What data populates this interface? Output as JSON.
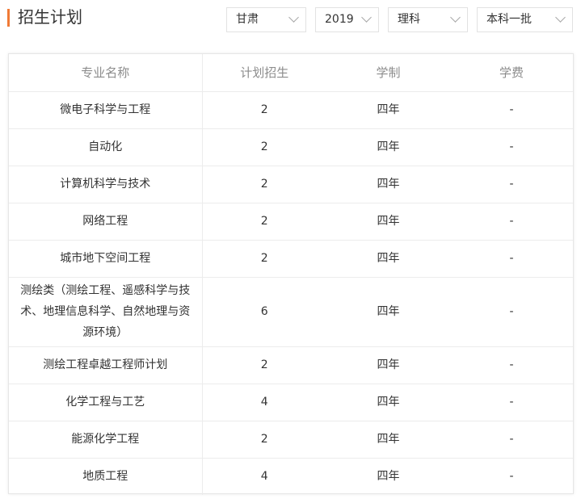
{
  "page": {
    "title": "招生计划"
  },
  "filters": {
    "province": "甘肃",
    "year": "2019",
    "subject": "理科",
    "batch": "本科一批"
  },
  "table": {
    "headers": [
      "专业名称",
      "计划招生",
      "学制",
      "学费"
    ],
    "rows": [
      {
        "name": "微电子科学与工程",
        "count": "2",
        "duration": "四年",
        "fee": "-"
      },
      {
        "name": "自动化",
        "count": "2",
        "duration": "四年",
        "fee": "-"
      },
      {
        "name": "计算机科学与技术",
        "count": "2",
        "duration": "四年",
        "fee": "-"
      },
      {
        "name": "网络工程",
        "count": "2",
        "duration": "四年",
        "fee": "-"
      },
      {
        "name": "城市地下空间工程",
        "count": "2",
        "duration": "四年",
        "fee": "-"
      },
      {
        "name": "测绘类（测绘工程、遥感科学与技术、地理信息科学、自然地理与资源环境）",
        "count": "6",
        "duration": "四年",
        "fee": "-"
      },
      {
        "name": "测绘工程卓越工程师计划",
        "count": "2",
        "duration": "四年",
        "fee": "-"
      },
      {
        "name": "化学工程与工艺",
        "count": "4",
        "duration": "四年",
        "fee": "-"
      },
      {
        "name": "能源化学工程",
        "count": "2",
        "duration": "四年",
        "fee": "-"
      },
      {
        "name": "地质工程",
        "count": "4",
        "duration": "四年",
        "fee": "-"
      }
    ]
  },
  "colors": {
    "accent": "#f07a36",
    "border": "#e2e2e2",
    "header_text": "#8c8c8c"
  },
  "icons": {
    "dropdown": "chevron-down-icon"
  }
}
